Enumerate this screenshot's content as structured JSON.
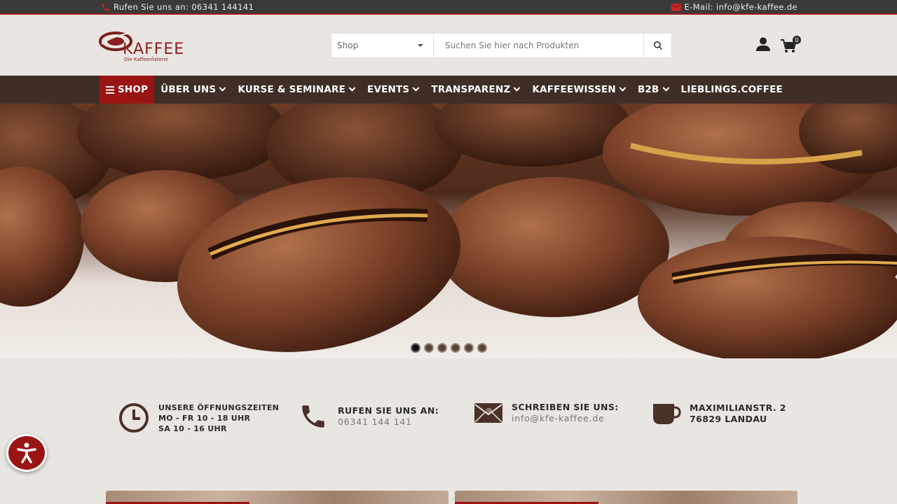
{
  "topbar": {
    "phone_text": "Rufen Sie uns an: 06341 144141",
    "email_text": "E-Mail: info@kfe-kaffee.de",
    "phone_icon": "phone-icon",
    "mail_icon": "mail-icon"
  },
  "header": {
    "logo_text": "KAFFEE",
    "logo_subtitle": "Die Kaffeerösterei",
    "search": {
      "category_value": "Shop",
      "placeholder": "Suchen Sie hier nach Produkten"
    },
    "cart_count": "0"
  },
  "nav": {
    "items": [
      {
        "label": "SHOP"
      },
      {
        "label": "ÜBER UNS"
      },
      {
        "label": "KURSE & SEMINARE"
      },
      {
        "label": "EVENTS"
      },
      {
        "label": "TRANSPARENZ"
      },
      {
        "label": "KAFFEEWISSEN"
      },
      {
        "label": "B2B"
      },
      {
        "label": "LIEBLINGS.COFFEE"
      }
    ]
  },
  "hero": {
    "slides_total": 6,
    "active_slide": 1
  },
  "info": {
    "hours": {
      "title": "UNSERE ÖFFNUNGSZEITEN",
      "line1": "MO - FR 10 - 18 UHR",
      "line2": "SA 10 - 16 UHR"
    },
    "call": {
      "title": "RUFEN SIE UNS AN:",
      "value": "06341 144 141"
    },
    "write": {
      "title": "SCHREIBEN SIE UNS:",
      "value": "info@kfe-kaffee.de"
    },
    "address": {
      "line1": "MAXIMILIANSTR. 2",
      "line2": "76829 LANDAU"
    }
  },
  "colors": {
    "accent_red": "#9b1414",
    "nav_brown": "#3f2e25",
    "topbar": "#3a3a3a",
    "background": "#e9e6e1"
  }
}
